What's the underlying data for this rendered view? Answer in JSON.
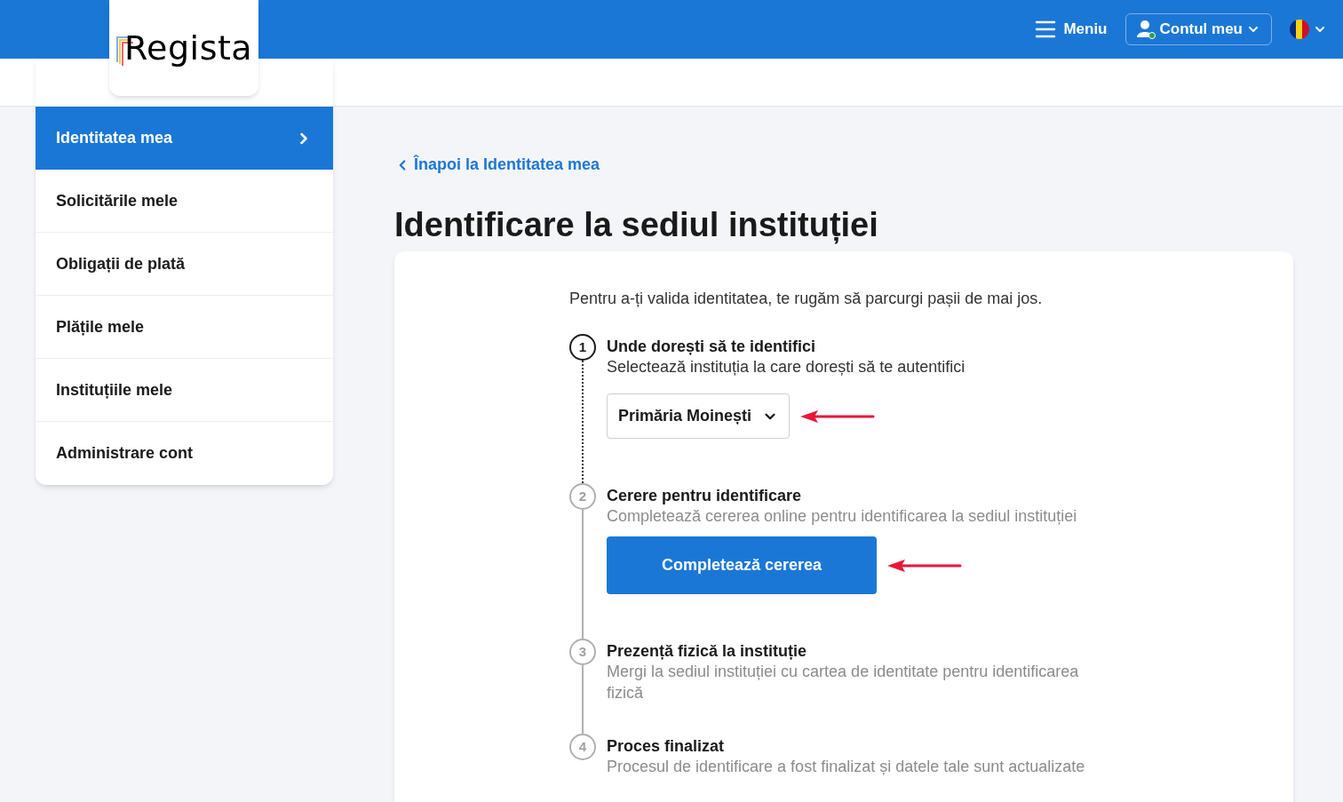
{
  "header": {
    "logo": "Regista",
    "menu_label": "Meniu",
    "account_label": "Contul meu",
    "account_online": true
  },
  "sidebar": {
    "items": [
      {
        "label": "Identitatea mea",
        "selected": true
      },
      {
        "label": "Solicitările mele",
        "selected": false
      },
      {
        "label": "Obligații de plată",
        "selected": false
      },
      {
        "label": "Plățile mele",
        "selected": false
      },
      {
        "label": "Instituțiile mele",
        "selected": false
      },
      {
        "label": "Administrare cont",
        "selected": false
      }
    ]
  },
  "back_link": "Înapoi la Identitatea mea",
  "title": "Identificare la sediul instituției",
  "intro": "Pentru a-ți valida identitatea, te rugăm să parcurgi pașii de mai jos.",
  "steps": [
    {
      "number": "1",
      "title": "Unde dorești să te identifici",
      "description": "Selectează instituția la care dorești să te autentifici",
      "active": true,
      "kind": "select",
      "value": "Primăria Moinești"
    },
    {
      "number": "2",
      "title": "Cerere pentru identificare",
      "description": "Completează cererea online pentru identificarea la sediul instituției",
      "active": false,
      "kind": "button",
      "value": "Completează cererea"
    },
    {
      "number": "3",
      "title": "Prezență fizică la instituție",
      "description": "Mergi la sediul instituției cu cartea de identitate pentru identificarea fizică",
      "active": false,
      "kind": "text"
    },
    {
      "number": "4",
      "title": "Proces finalizat",
      "description": "Procesul de identificare a fost finalizat și datele tale sunt actualizate",
      "active": false,
      "kind": "text"
    }
  ]
}
